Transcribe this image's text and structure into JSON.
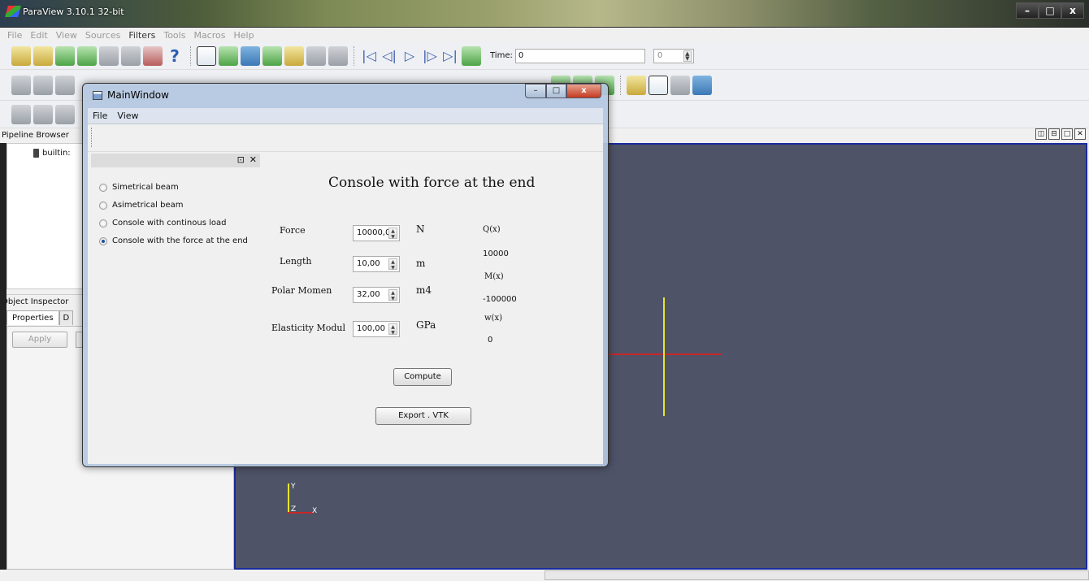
{
  "app": {
    "title": "ParaView 3.10.1 32-bit"
  },
  "menubar": [
    "File",
    "Edit",
    "View",
    "Sources",
    "Filters",
    "Tools",
    "Macros",
    "Help"
  ],
  "toolbar": {
    "time_label": "Time:",
    "time_value": "0",
    "time_step": "0"
  },
  "pipeline": {
    "header": "Pipeline Browser",
    "server": "builtin:"
  },
  "object_inspector": {
    "header": "Object Inspector",
    "tabs": [
      "Properties",
      "D"
    ],
    "apply_label": "Apply"
  },
  "render_axes": {
    "y": "Y",
    "z": "Z",
    "x": "X"
  },
  "dialog": {
    "title": "MainWindow",
    "menu": [
      "File",
      "View"
    ],
    "dock_buttons": [
      "⊡",
      "✕"
    ],
    "options": [
      {
        "label": "Simetrical beam",
        "checked": false
      },
      {
        "label": "Asimetrical beam",
        "checked": false
      },
      {
        "label": "Console with continous load",
        "checked": false
      },
      {
        "label": "Console with the force at the end",
        "checked": true
      }
    ],
    "heading": "Console with force at the end",
    "inputs": {
      "force": {
        "label": "Force",
        "value": "10000,0(",
        "unit": "N"
      },
      "length": {
        "label": "Length",
        "value": "10,00",
        "unit": "m"
      },
      "polar": {
        "label": "Polar Momen",
        "value": "32,00",
        "unit": "m4"
      },
      "elasticity": {
        "label": "Elasticity Modul",
        "value": "100,00",
        "unit": "GPa"
      }
    },
    "results": {
      "q_label": "Q(x)",
      "q_value": "10000",
      "m_label": "M(x)",
      "m_value": "-100000",
      "w_label": "w(x)",
      "w_value": "0"
    },
    "compute_label": "Compute",
    "export_label": "Export . VTK"
  },
  "colors": {
    "render_bg": "#4f5368",
    "render_border": "#1a2c9c",
    "axis_x": "#c62828",
    "axis_y": "#e5e52c"
  }
}
